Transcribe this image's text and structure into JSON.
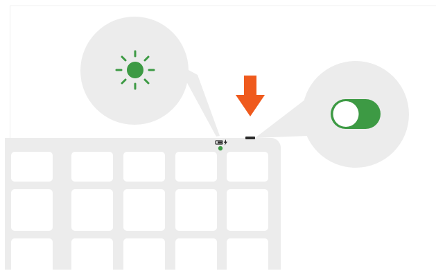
{
  "colors": {
    "accent_green": "#3d9a44",
    "arrow_orange": "#ef5a1d",
    "callout_gray": "#ececec",
    "keyboard_gray": "#ececec",
    "key_white": "#ffffff",
    "indicator_dark": "#2b2b2b"
  },
  "icons": {
    "brightness": "sun-icon",
    "toggle": "toggle-switch-on-icon",
    "arrow": "arrow-down-icon",
    "battery": "battery-charging-icon",
    "status_light": "status-led-icon"
  },
  "toggle_state": "on"
}
